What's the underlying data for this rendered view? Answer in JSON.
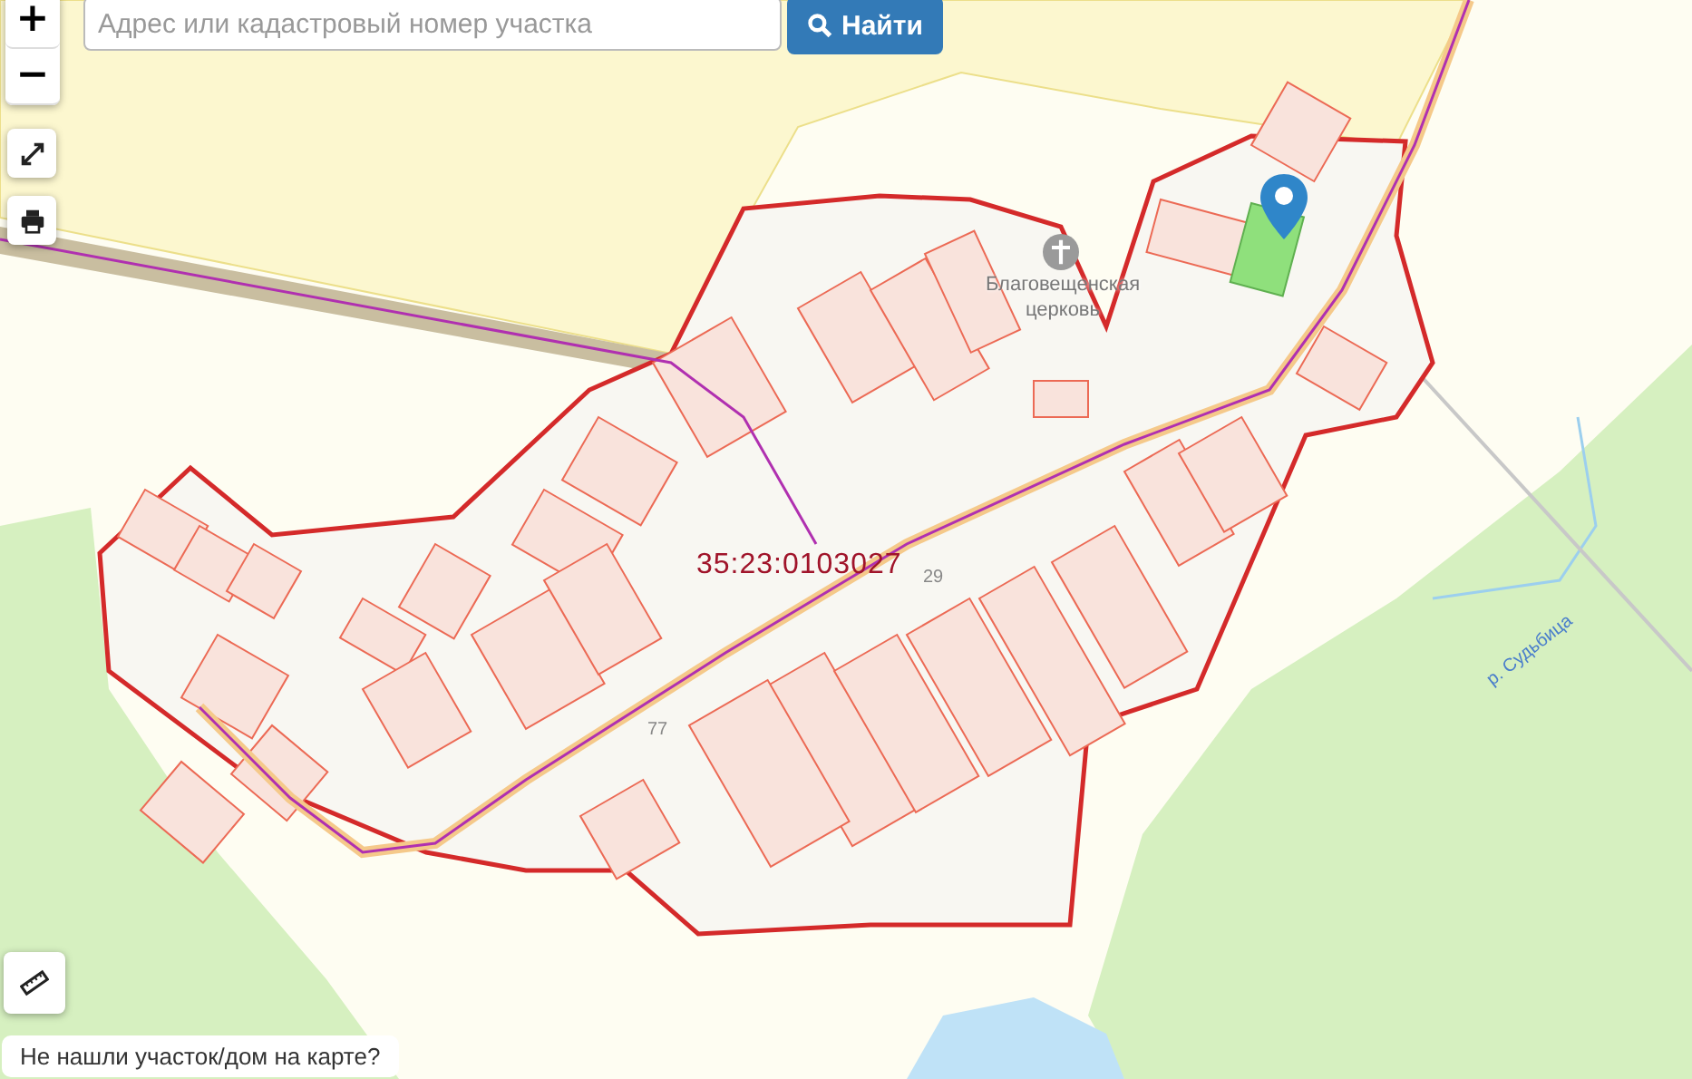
{
  "map": {
    "search": {
      "placeholder": "Адрес или кадастровый номер участка"
    },
    "search_button": "Найти",
    "zoom_in": "+",
    "zoom_out": "−",
    "labels": [
      {
        "kind": "poi",
        "text": "Благовещенская церковь"
      },
      {
        "kind": "cadastral",
        "text": "35:23:0103027"
      },
      {
        "kind": "house",
        "text": "29"
      },
      {
        "kind": "house",
        "text": "77"
      },
      {
        "kind": "river",
        "text": "р. Судьбица"
      }
    ],
    "help_link": "Не нашли участок/дом на карте?"
  }
}
